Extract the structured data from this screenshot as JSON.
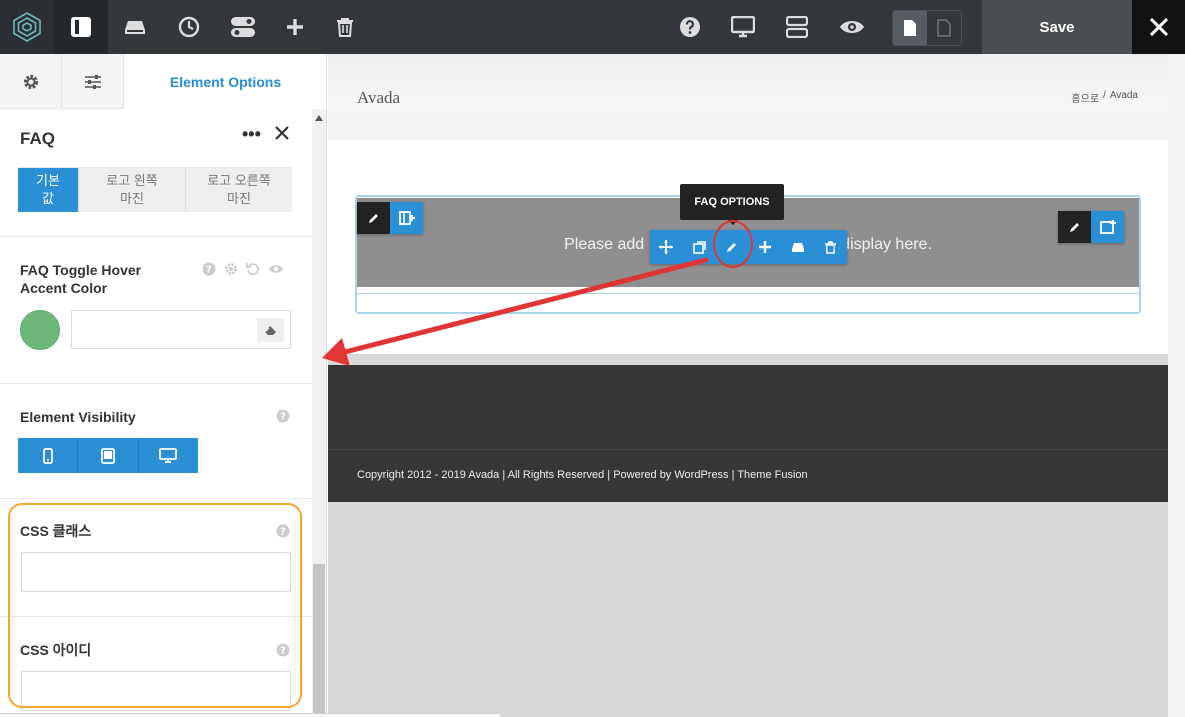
{
  "toolbar": {
    "save_label": "Save",
    "icons": [
      "avada-logo-icon",
      "panel-toggle-icon",
      "library-icon",
      "history-icon",
      "toggle-icon",
      "add-icon",
      "trash-icon",
      "help-icon",
      "desktop-icon",
      "layout-icon",
      "preview-eye-icon",
      "page-icon",
      "page-outline-icon",
      "close-icon"
    ]
  },
  "sidebar": {
    "tabs": {
      "settings": "settings",
      "sliders": "sliders",
      "element_options": "Element Options"
    },
    "title": "FAQ",
    "more": "•••",
    "margin_tabs": [
      "기본\n값",
      "로고 왼쪽\n마진",
      "로고 오른쪽\n마진"
    ],
    "hover_color_label": "FAQ Toggle Hover\nAccent Color",
    "hover_color_value": "#6db879",
    "visibility_label": "Element Visibility",
    "css_class_label": "CSS 클래스",
    "css_class_value": "",
    "css_id_label": "CSS 아이디",
    "css_id_value": ""
  },
  "preview": {
    "brand": "Avada",
    "breadcrumb": {
      "home": "홈으로",
      "sep": "/",
      "current": "Avada"
    },
    "placeholder_left": "Please add",
    "placeholder_right": "display here.",
    "tooltip": "FAQ OPTIONS",
    "footer_copyright": "Copyright 2012 - 2019 Avada | All Rights Reserved | Powered by WordPress | Theme Fusion"
  },
  "colors": {
    "accent": "#2b8fd6",
    "toolbar_bg": "#33373c",
    "highlight_orange": "#f0a830",
    "annotation_red": "#e03535"
  }
}
